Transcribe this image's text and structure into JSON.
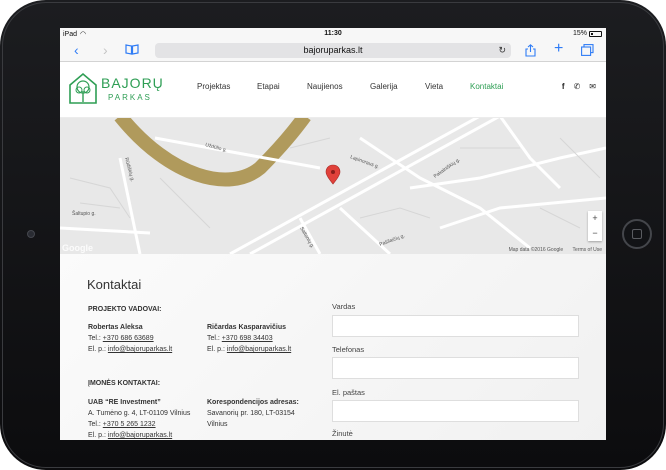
{
  "status_bar": {
    "carrier": "iPad",
    "time": "11:30",
    "battery": "15%"
  },
  "browser": {
    "url": "bajoruparkas.lt"
  },
  "logo": {
    "line1": "BAJORŲ",
    "line2": "PARKAS"
  },
  "menu": [
    "Projektas",
    "Etapai",
    "Naujienos",
    "Galerija",
    "Vieta",
    "Kontaktai"
  ],
  "menu_active": "Kontaktai",
  "social": [
    "facebook-icon",
    "skype-icon",
    "mail-icon"
  ],
  "map": {
    "labels": [
      "Uždūlio g.",
      "Šaltupio g.",
      "Lapinoraus g.",
      "Pakalniškių g.",
      "Saltonių g.",
      "Pašilaičių g.",
      "Rūdiškių g."
    ],
    "zoom_in": "+",
    "zoom_out": "−",
    "attribution": "Map data ©2016 Google",
    "terms": "Terms of Use",
    "google": "Google",
    "marker_color": "#e0413a"
  },
  "contact": {
    "title": "Kontaktai",
    "project_heading": "PROJEKTO VADOVAI:",
    "managers": [
      {
        "name": "Robertas Aleksa",
        "tel_label": "Tel.:",
        "tel": "+370 686 63689",
        "email_label": "El. p.:",
        "email": "info@bajoruparkas.lt"
      },
      {
        "name": "Ričardas Kasparavičius",
        "tel_label": "Tel.:",
        "tel": "+370 698 34403",
        "email_label": "El. p.:",
        "email": "info@bajoruparkas.lt"
      }
    ],
    "company_heading": "ĮMONĖS KONTAKTAI:",
    "company": {
      "name": "UAB “RE Investment”",
      "address": "A. Tumėno g. 4, LT-01109 Vilnius",
      "tel_label": "Tel.:",
      "tel": "+370 5 265 1232",
      "email_label": "El. p.:",
      "email": "info@bajoruparkas.lt"
    },
    "correspondence": {
      "heading": "Korespondencijos adresas:",
      "line1": "Savanorių pr. 180, LT-03154",
      "line2": "Vilnius"
    }
  },
  "form": {
    "name_label": "Vardas",
    "phone_label": "Telefonas",
    "email_label": "El. paštas",
    "message_label": "Žinutė"
  },
  "colors": {
    "brand_green": "#2e9e54",
    "safari_blue": "#2f7cf6"
  }
}
